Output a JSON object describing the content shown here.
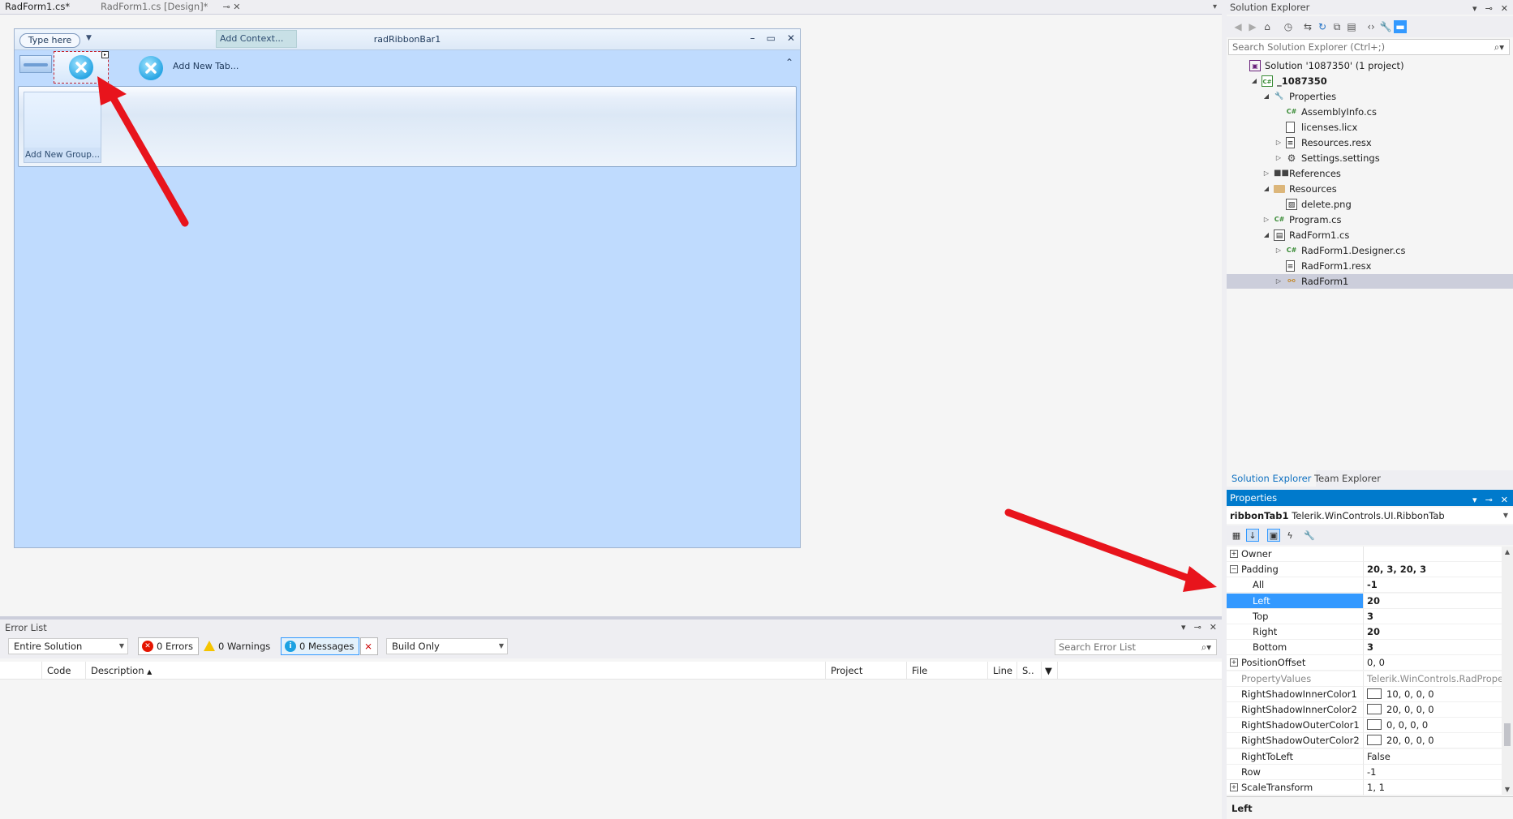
{
  "doc_tabs": [
    {
      "label": "RadForm1.cs*",
      "active": true
    },
    {
      "label": "RadForm1.cs [Design]*",
      "active": false
    }
  ],
  "designer": {
    "type_here": "Type here",
    "add_context": "Add Context...",
    "caption": "radRibbonBar1",
    "add_new_tab": "Add New Tab...",
    "add_new_group": "Add New Group..."
  },
  "error_list": {
    "title": "Error List",
    "scope": "Entire Solution",
    "errors": "0 Errors",
    "warnings": "0 Warnings",
    "messages": "0 Messages",
    "build_filter": "Build Only",
    "search_placeholder": "Search Error List",
    "columns": [
      "Code",
      "Description",
      "Project",
      "File",
      "Line",
      "S.."
    ]
  },
  "solution_explorer": {
    "title": "Solution Explorer",
    "search_placeholder": "Search Solution Explorer (Ctrl+;)",
    "tree": [
      {
        "label": "Solution '1087350' (1 project)",
        "icon": "solution-icon",
        "level": 0,
        "expander": ""
      },
      {
        "label": "_1087350",
        "icon": "csharp-project-icon",
        "level": 1,
        "expander": "expanded",
        "bold": true
      },
      {
        "label": "Properties",
        "icon": "wrench-icon",
        "level": 2,
        "expander": "expanded"
      },
      {
        "label": "AssemblyInfo.cs",
        "icon": "csharp-file-icon",
        "level": 3,
        "expander": ""
      },
      {
        "label": "licenses.licx",
        "icon": "file-icon",
        "level": 3,
        "expander": ""
      },
      {
        "label": "Resources.resx",
        "icon": "resx-icon",
        "level": 3,
        "expander": "collapsed"
      },
      {
        "label": "Settings.settings",
        "icon": "gear-icon",
        "level": 3,
        "expander": "collapsed"
      },
      {
        "label": "References",
        "icon": "references-icon",
        "level": 2,
        "expander": "collapsed"
      },
      {
        "label": "Resources",
        "icon": "folder-icon",
        "level": 2,
        "expander": "expanded"
      },
      {
        "label": "delete.png",
        "icon": "image-file-icon",
        "level": 3,
        "expander": ""
      },
      {
        "label": "Program.cs",
        "icon": "csharp-file-icon",
        "level": 2,
        "expander": "collapsed"
      },
      {
        "label": "RadForm1.cs",
        "icon": "form-icon",
        "level": 2,
        "expander": "expanded"
      },
      {
        "label": "RadForm1.Designer.cs",
        "icon": "csharp-file-icon",
        "level": 3,
        "expander": "collapsed"
      },
      {
        "label": "RadForm1.resx",
        "icon": "resx-icon",
        "level": 3,
        "expander": ""
      },
      {
        "label": "RadForm1",
        "icon": "class-icon",
        "level": 3,
        "expander": "collapsed",
        "selected": true
      }
    ],
    "tabs": [
      "Solution Explorer",
      "Team Explorer"
    ]
  },
  "properties": {
    "title": "Properties",
    "object_name": "ribbonTab1",
    "object_type": "Telerik.WinControls.UI.RibbonTab",
    "rows": [
      {
        "name": "Owner",
        "value": "",
        "expander": "+",
        "indent": 0
      },
      {
        "name": "Padding",
        "value": "20, 3, 20, 3",
        "expander": "-",
        "indent": 0,
        "bold": true
      },
      {
        "name": "All",
        "value": "-1",
        "indent": 1,
        "bold": true
      },
      {
        "name": "Left",
        "value": "20",
        "indent": 1,
        "bold": true,
        "highlight": true
      },
      {
        "name": "Top",
        "value": "3",
        "indent": 1,
        "bold": true
      },
      {
        "name": "Right",
        "value": "20",
        "indent": 1,
        "bold": true
      },
      {
        "name": "Bottom",
        "value": "3",
        "indent": 1,
        "bold": true
      },
      {
        "name": "PositionOffset",
        "value": "0, 0",
        "expander": "+",
        "indent": 0
      },
      {
        "name": "PropertyValues",
        "value": "Telerik.WinControls.RadPrope",
        "indent": 0,
        "dim": true
      },
      {
        "name": "RightShadowInnerColor1",
        "value": "10, 0, 0, 0",
        "indent": 0,
        "swatch": true
      },
      {
        "name": "RightShadowInnerColor2",
        "value": "20, 0, 0, 0",
        "indent": 0,
        "swatch": true
      },
      {
        "name": "RightShadowOuterColor1",
        "value": "0, 0, 0, 0",
        "indent": 0,
        "swatch": true
      },
      {
        "name": "RightShadowOuterColor2",
        "value": "20, 0, 0, 0",
        "indent": 0,
        "swatch": true
      },
      {
        "name": "RightToLeft",
        "value": "False",
        "indent": 0
      },
      {
        "name": "Row",
        "value": "-1",
        "indent": 0
      },
      {
        "name": "ScaleTransform",
        "value": "1, 1",
        "expander": "+",
        "indent": 0
      }
    ],
    "description_title": "Left"
  },
  "colors": {
    "accent": "#007acc",
    "selection": "#3399ff",
    "arrow": "#e8141c",
    "form_background": "#bfdbfe"
  }
}
